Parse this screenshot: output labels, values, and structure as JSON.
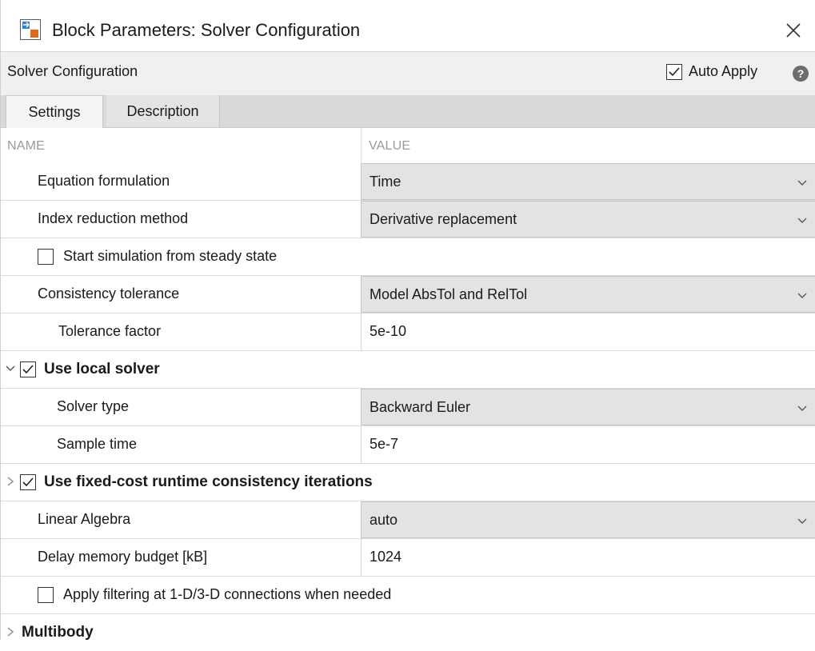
{
  "window": {
    "title": "Block Parameters: Solver Configuration",
    "app_icon": "simulink-block-icon",
    "close_icon": "close-icon"
  },
  "header": {
    "block_name": "Solver Configuration",
    "auto_apply_label": "Auto Apply",
    "auto_apply_checked": true,
    "help_glyph": "?"
  },
  "tabs": [
    {
      "label": "Settings",
      "active": true
    },
    {
      "label": "Description",
      "active": false
    }
  ],
  "columns": {
    "name": "NAME",
    "value": "VALUE"
  },
  "rows": [
    {
      "kind": "dropdown",
      "label": "Equation formulation",
      "value": "Time"
    },
    {
      "kind": "dropdown",
      "label": "Index reduction method",
      "value": "Derivative replacement"
    },
    {
      "kind": "checkbox",
      "label": "Start simulation from steady state",
      "checked": false
    },
    {
      "kind": "dropdown",
      "label": "Consistency tolerance",
      "value": "Model AbsTol and RelTol"
    },
    {
      "kind": "text",
      "label": "Tolerance factor",
      "value": "5e-10"
    },
    {
      "kind": "section",
      "label": "Use local solver",
      "checked": true,
      "expanded": true
    },
    {
      "kind": "dropdown",
      "label": "Solver type",
      "value": "Backward Euler"
    },
    {
      "kind": "text",
      "label": "Sample time",
      "value": "5e-7"
    },
    {
      "kind": "section",
      "label": "Use fixed-cost runtime consistency iterations",
      "checked": true,
      "expanded": false
    },
    {
      "kind": "dropdown",
      "label": "Linear Algebra",
      "value": "auto"
    },
    {
      "kind": "text",
      "label": "Delay memory budget [kB]",
      "value": "1024"
    },
    {
      "kind": "checkbox",
      "label": "Apply filtering at 1-D/3-D connections when needed",
      "checked": false
    },
    {
      "kind": "group",
      "label": "Multibody",
      "expanded": false
    }
  ]
}
